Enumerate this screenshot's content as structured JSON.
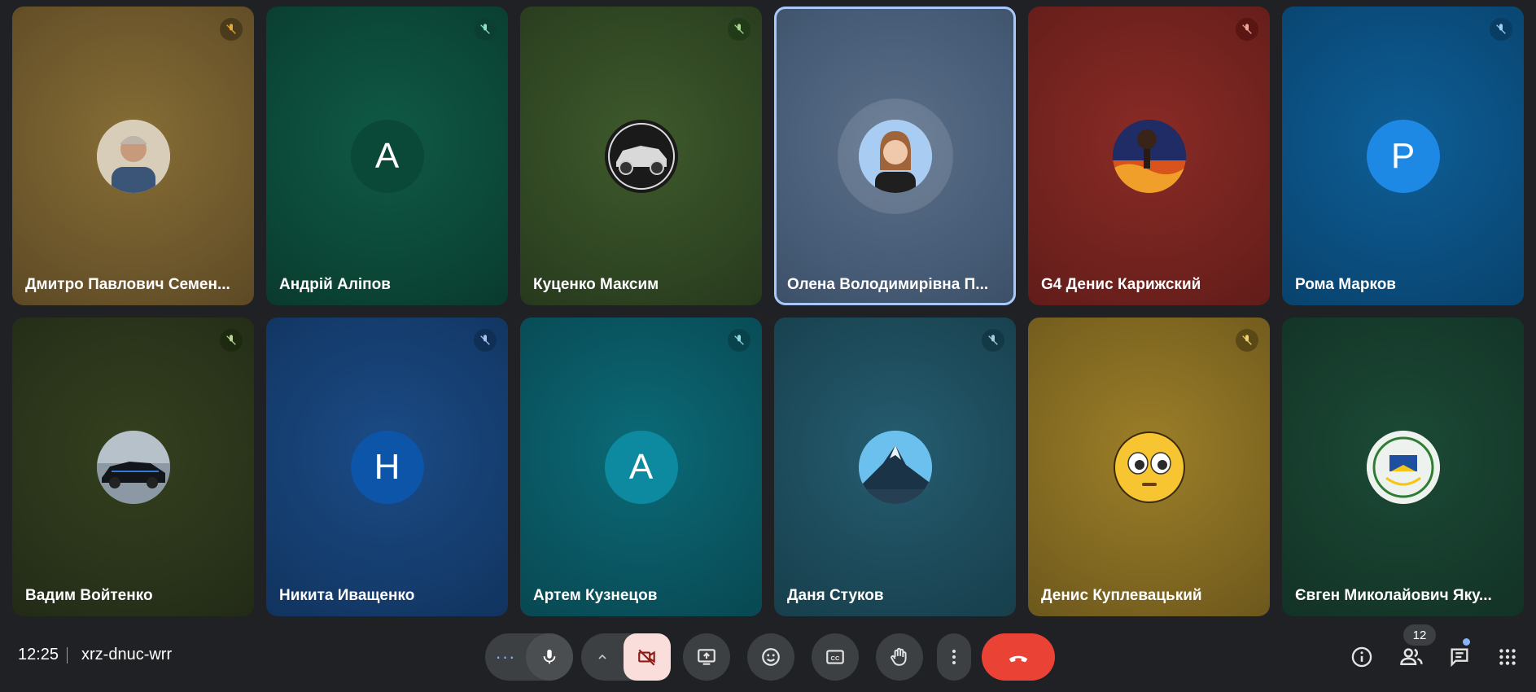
{
  "participants": [
    {
      "name": "Дмитро Павлович Семен...",
      "avatar": "photo-man-glasses"
    },
    {
      "name": "Андрій Аліпов",
      "avatar_initial": "А"
    },
    {
      "name": "Куценко Максим",
      "avatar": "photo-suv-car"
    },
    {
      "name": "Олена Володимирівна П...",
      "avatar": "photo-woman",
      "active": true
    },
    {
      "name": "G4 Денис Карижский",
      "avatar": "photo-fire-scene"
    },
    {
      "name": "Рома Марков",
      "avatar_initial": "Р"
    },
    {
      "name": "Вадим Войтенко",
      "avatar": "photo-black-car"
    },
    {
      "name": "Никита Иващенко",
      "avatar_initial": "Н"
    },
    {
      "name": "Артем Кузнецов",
      "avatar_initial": "А"
    },
    {
      "name": "Даня Стуков",
      "avatar": "photo-mountain"
    },
    {
      "name": "Денис Куплевацький",
      "avatar": "emoji-flushed-face"
    },
    {
      "name": "Євген Миколайович Яку...",
      "avatar": "emblem-logo"
    }
  ],
  "meeting": {
    "time": "12:25",
    "code": "xrz-dnuc-wrr"
  },
  "controls": {
    "more_audio": "more-horiz-icon",
    "mic": "mic-icon",
    "camera_options": "chevron-up-icon",
    "camera_off": "videocam-off-icon",
    "present": "present-screen-icon",
    "reactions": "emoji-icon",
    "captions": "closed-captions-icon",
    "raise_hand": "hand-icon",
    "more": "more-vert-icon",
    "leave": "call-end-icon"
  },
  "side_controls": {
    "participants_count": "12"
  },
  "colors": {
    "accent": "#a8c7fa",
    "end_call": "#ea4335",
    "camera_off_bg": "#f9dedc",
    "background": "#202124"
  }
}
